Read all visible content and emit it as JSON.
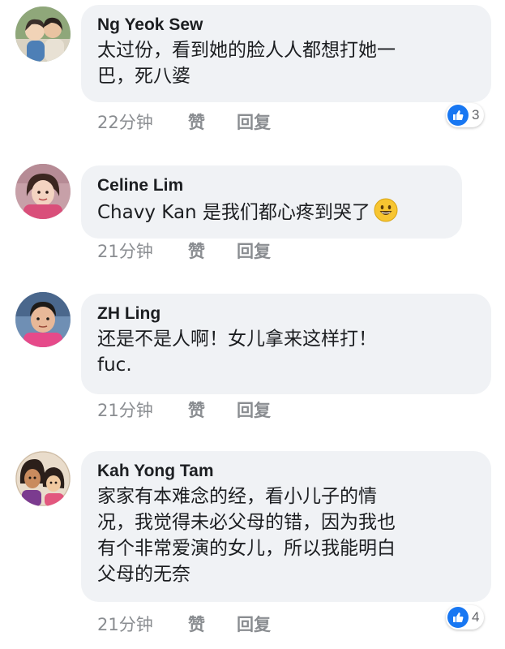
{
  "comments": [
    {
      "author": "Ng Yeok Sew",
      "text": "太过份，看到她的脸人人都想打她一\n巴，死八婆",
      "time": "22分钟",
      "like_label": "赞",
      "reply_label": "回复",
      "reactions": "3"
    },
    {
      "author": "Celine Lim",
      "text": "Chavy Kan 是我们都心疼到哭了",
      "emoji": "smiley-face-icon",
      "time": "21分钟",
      "like_label": "赞",
      "reply_label": "回复"
    },
    {
      "author": "ZH Ling",
      "text": "还是不是人啊！女儿拿来这样打！\nfuc.",
      "time": "21分钟",
      "like_label": "赞",
      "reply_label": "回复"
    },
    {
      "author": "Kah Yong Tam",
      "text": "家家有本难念的经，看小儿子的情\n况，我觉得未必父母的错，因为我也\n有个非常爱演的女儿，所以我能明白\n父母的无奈",
      "time": "21分钟",
      "like_label": "赞",
      "reply_label": "回复",
      "reactions": "4"
    }
  ],
  "colors": {
    "bubble": "#f0f2f5",
    "meta_text": "#8a8d91",
    "like_blue": "#1877f2",
    "emoji_yellow": "#f7c531"
  }
}
